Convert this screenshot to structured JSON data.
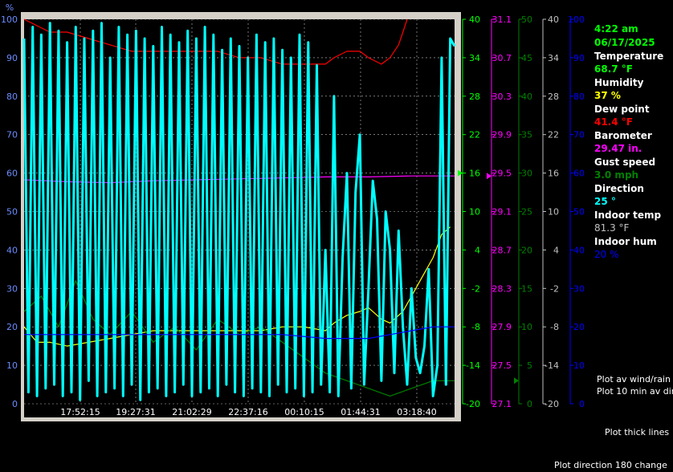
{
  "colors": {
    "background": "#000000",
    "frame": "#d4d0c8",
    "plot_bg": "#000000",
    "grid": "#c0c0c0",
    "humidity": "#ffff00",
    "temperature": "#00ff00",
    "dewpoint": "#ff0000",
    "barometer": "#ff00ff",
    "gust": "#008000",
    "direction": "#00ffff",
    "indoor_temp": "#c0c0c0",
    "indoor_hum": "#0000ff",
    "text": "#ffffff"
  },
  "readout": {
    "time": "4:22 am",
    "date": "06/17/2025",
    "temperature_label": "Temperature",
    "temperature_value": "68.7 °F",
    "humidity_label": "Humidity",
    "humidity_value": "37 %",
    "dewpoint_label": "Dew point",
    "dewpoint_value": "41.4 °F",
    "barometer_label": "Barometer",
    "barometer_value": "29.47 in.",
    "gust_label": "Gust speed",
    "gust_value": "3.0 mph",
    "direction_label": "Direction",
    "direction_value": "25 °",
    "indoor_temp_label": "Indoor temp",
    "indoor_temp_value": "81.3 °F",
    "indoor_hum_label": "Indoor hum",
    "indoor_hum_value": "20 %"
  },
  "options": {
    "plot_av_wind": "Plot av wind/rain",
    "plot_10min_dir": "Plot 10 min av dir",
    "plot_thick": "Plot thick lines",
    "plot_dir_180": "Plot direction 180 change"
  },
  "chart_data": {
    "type": "line",
    "grid": true,
    "x_tick_labels": [
      "17:52:15",
      "19:27:31",
      "21:02:29",
      "22:37:16",
      "00:10:15",
      "01:44:31",
      "03:18:40"
    ],
    "axes": {
      "percent": {
        "unit": "%",
        "range": [
          0,
          100
        ],
        "ticks": [
          "0",
          "10",
          "20",
          "30",
          "40",
          "50",
          "60",
          "70",
          "80",
          "90",
          "100"
        ]
      },
      "temperature": {
        "range": [
          -20,
          40
        ],
        "ticks": [
          "-20",
          "-14",
          "-8",
          "-2",
          "4",
          "10",
          "16",
          "22",
          "28",
          "34",
          "40"
        ],
        "marker": 16
      },
      "barometer": {
        "range": [
          27.1,
          31.1
        ],
        "ticks": [
          "27.1",
          "27.5",
          "27.9",
          "28.3",
          "28.7",
          "29.1",
          "29.5",
          "29.9",
          "30.3",
          "30.7",
          "31.1"
        ],
        "marker": 29.47
      },
      "gust": {
        "range": [
          0,
          50
        ],
        "ticks": [
          "0",
          "5",
          "10",
          "15",
          "20",
          "25",
          "30",
          "35",
          "40",
          "45",
          "50"
        ],
        "marker": 3
      },
      "indoor_temp": {
        "range": [
          -20,
          40
        ],
        "ticks": [
          "-20",
          "-14",
          "-8",
          "-2",
          "4",
          "10",
          "16",
          "22",
          "28",
          "34",
          "40"
        ]
      },
      "indoor_hum": {
        "range": [
          0,
          100
        ],
        "ticks": [
          "0",
          "10",
          "20",
          "30",
          "40",
          "50",
          "60",
          "70",
          "80",
          "90",
          "100"
        ]
      }
    },
    "series": [
      {
        "name": "Humidity",
        "axis": "percent",
        "color": "#ffff00",
        "x": [
          0,
          0.03,
          0.06,
          0.1,
          0.15,
          0.2,
          0.25,
          0.3,
          0.35,
          0.4,
          0.45,
          0.5,
          0.55,
          0.6,
          0.65,
          0.7,
          0.72,
          0.75,
          0.78,
          0.8,
          0.83,
          0.85,
          0.88,
          0.9,
          0.92,
          0.95,
          0.97,
          0.99
        ],
        "y": [
          20,
          16,
          16,
          15,
          16,
          17,
          18,
          19,
          19,
          19,
          19,
          19,
          19,
          20,
          20,
          19,
          21,
          23,
          24,
          25,
          22,
          21,
          24,
          28,
          32,
          38,
          44,
          46
        ]
      },
      {
        "name": "Dew point",
        "axis": "temperature",
        "color": "#ff0000",
        "x": [
          0,
          0.03,
          0.06,
          0.1,
          0.15,
          0.2,
          0.25,
          0.3,
          0.35,
          0.4,
          0.45,
          0.5,
          0.55,
          0.6,
          0.65,
          0.7,
          0.72,
          0.75,
          0.78,
          0.8,
          0.83,
          0.85,
          0.87,
          0.88,
          0.89
        ],
        "y": [
          40,
          39,
          38,
          38,
          37,
          36,
          35,
          35,
          35,
          35,
          35,
          34,
          34,
          33,
          33,
          33,
          34,
          35,
          35,
          34,
          33,
          34,
          36,
          38,
          40
        ]
      },
      {
        "name": "Barometer",
        "axis": "barometer",
        "color": "#ff00ff",
        "x": [
          0,
          0.1,
          0.2,
          0.3,
          0.4,
          0.5,
          0.6,
          0.7,
          0.8,
          0.9,
          1.0
        ],
        "y": [
          29.43,
          29.41,
          29.4,
          29.42,
          29.43,
          29.44,
          29.45,
          29.46,
          29.46,
          29.47,
          29.47
        ]
      },
      {
        "name": "Gust speed",
        "axis": "gust",
        "color": "#008000",
        "x": [
          0,
          0.04,
          0.08,
          0.12,
          0.16,
          0.2,
          0.25,
          0.3,
          0.35,
          0.4,
          0.45,
          0.5,
          0.55,
          0.6,
          0.65,
          0.7,
          0.75,
          0.8,
          0.85,
          0.9,
          0.95,
          1.0
        ],
        "y": [
          12,
          14,
          10,
          16,
          11,
          9,
          12,
          8,
          10,
          7,
          11,
          9,
          10,
          8,
          6,
          4,
          3,
          2,
          1,
          2,
          3,
          3
        ]
      },
      {
        "name": "Direction",
        "axis": "percent",
        "color": "#00ffff",
        "x": [
          0,
          0.01,
          0.02,
          0.03,
          0.04,
          0.05,
          0.06,
          0.07,
          0.08,
          0.09,
          0.1,
          0.11,
          0.12,
          0.13,
          0.14,
          0.15,
          0.16,
          0.17,
          0.18,
          0.19,
          0.2,
          0.21,
          0.22,
          0.23,
          0.24,
          0.25,
          0.26,
          0.27,
          0.28,
          0.29,
          0.3,
          0.31,
          0.32,
          0.33,
          0.34,
          0.35,
          0.36,
          0.37,
          0.38,
          0.39,
          0.4,
          0.41,
          0.42,
          0.43,
          0.44,
          0.45,
          0.46,
          0.47,
          0.48,
          0.49,
          0.5,
          0.51,
          0.52,
          0.53,
          0.54,
          0.55,
          0.56,
          0.57,
          0.58,
          0.59,
          0.6,
          0.61,
          0.62,
          0.63,
          0.64,
          0.65,
          0.66,
          0.67,
          0.68,
          0.69,
          0.7,
          0.71,
          0.72,
          0.73,
          0.74,
          0.75,
          0.76,
          0.77,
          0.78,
          0.79,
          0.8,
          0.81,
          0.82,
          0.83,
          0.84,
          0.85,
          0.86,
          0.87,
          0.88,
          0.89,
          0.9,
          0.91,
          0.92,
          0.93,
          0.94,
          0.95,
          0.96,
          0.97,
          0.98,
          0.99,
          1.0
        ],
        "y": [
          95,
          3,
          98,
          2,
          96,
          4,
          99,
          5,
          97,
          2,
          94,
          3,
          98,
          1,
          95,
          6,
          97,
          2,
          99,
          3,
          90,
          4,
          98,
          2,
          96,
          5,
          97,
          1,
          95,
          3,
          93,
          4,
          98,
          2,
          96,
          3,
          94,
          5,
          97,
          2,
          95,
          3,
          98,
          4,
          96,
          2,
          92,
          5,
          95,
          3,
          93,
          2,
          90,
          4,
          96,
          3,
          94,
          2,
          95,
          5,
          92,
          3,
          90,
          4,
          96,
          2,
          94,
          3,
          88,
          5,
          40,
          3,
          80,
          2,
          38,
          60,
          4,
          55,
          70,
          5,
          30,
          58,
          48,
          6,
          50,
          40,
          8,
          45,
          20,
          5,
          30,
          12,
          8,
          15,
          35,
          2,
          10,
          90,
          5,
          95,
          93
        ]
      },
      {
        "name": "Indoor hum",
        "axis": "indoor_hum",
        "color": "#0000ff",
        "x": [
          0,
          0.1,
          0.2,
          0.3,
          0.4,
          0.5,
          0.6,
          0.7,
          0.75,
          0.8,
          0.85,
          0.9,
          0.95,
          1.0
        ],
        "y": [
          18,
          18,
          18,
          18,
          18,
          18,
          18,
          17,
          17,
          17,
          18,
          19,
          20,
          20
        ]
      }
    ]
  }
}
